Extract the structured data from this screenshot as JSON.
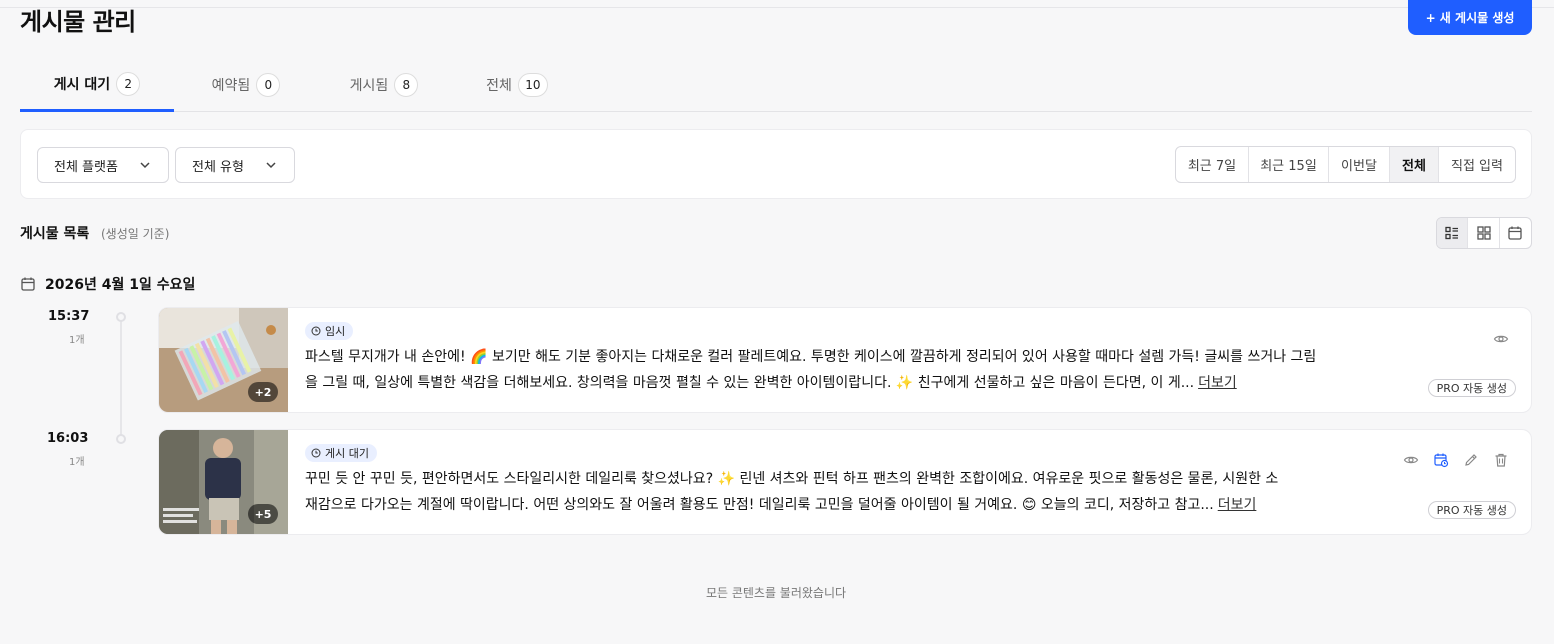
{
  "header": {
    "title": "게시물 관리",
    "create_button": "+ 새 게시물 생성"
  },
  "tabs": [
    {
      "label": "게시 대기",
      "count": "2",
      "active": true
    },
    {
      "label": "예약됨",
      "count": "0"
    },
    {
      "label": "게시됨",
      "count": "8"
    },
    {
      "label": "전체",
      "count": "10"
    }
  ],
  "filters": {
    "platform": "전체 플랫폼",
    "type": "전체 유형",
    "periods": [
      "최근 7일",
      "최근 15일",
      "이번달",
      "전체",
      "직접 입력"
    ],
    "selected_period": "전체"
  },
  "list": {
    "title": "게시물 목록",
    "subtitle": "(생성일 기준)",
    "view_modes": [
      "list-icon",
      "grid-icon",
      "calendar-icon"
    ],
    "selected_view": "list-icon"
  },
  "date_group": {
    "label": "2026년 4월 1일 수요일"
  },
  "posts": [
    {
      "time": "15:37",
      "count": "1개",
      "status": "임시",
      "more_images": "+2",
      "caption_line1": "파스텔 무지개가 내 손안에! 🌈 보기만 해도 기분 좋아지는 다채로운 컬러 팔레트예요. 투명한 케이스에 깔끔하게 정리되어 있어 사용할 때마다 설렘 가득! 글씨를 쓰거나 그림",
      "caption_line2": "을 그릴 때, 일상에 특별한 색감을 더해보세요. 창의력을 마음껏 펼칠 수 있는 완벽한 아이템이랍니다. ✨ 친구에게 선물하고 싶은 마음이 든다면, 이 게...",
      "more": "더보기",
      "pro": "PRO 자동 생성"
    },
    {
      "time": "16:03",
      "count": "1개",
      "status": "게시 대기",
      "more_images": "+5",
      "caption_line1": "꾸민 듯 안 꾸민 듯, 편안하면서도 스타일리시한 데일리룩 찾으셨나요? ✨ 린넨 셔츠와 핀턱 하프 팬츠의 완벽한 조합이에요. 여유로운 핏으로 활동성은 물론, 시원한 소",
      "caption_line2": "재감으로 다가오는 계절에 딱이랍니다. 어떤 상의와도 잘 어울려 활용도 만점! 데일리룩 고민을 덜어줄 아이템이 될 거예요. 😊 오늘의 코디, 저장하고 참고...",
      "more": "더보기",
      "pro": "PRO 자동 생성"
    }
  ],
  "footer": "모든 콘텐츠를 불러왔습니다",
  "colors": {
    "accent": "#1f5eff",
    "badge_bg": "#e9efff"
  }
}
